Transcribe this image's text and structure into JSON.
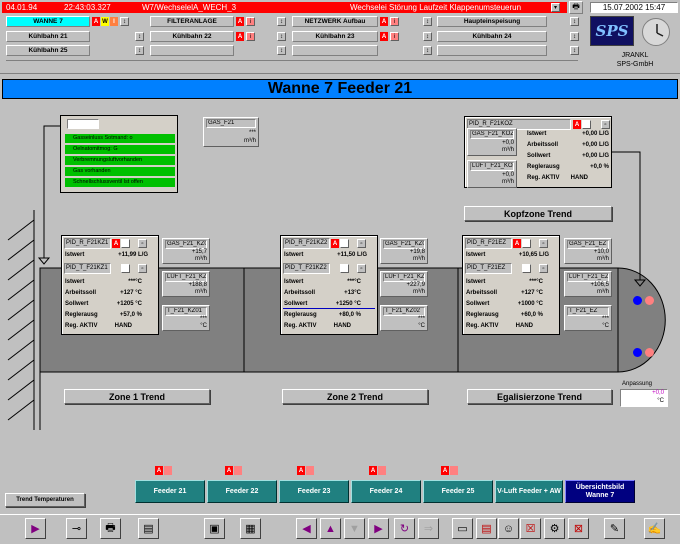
{
  "header": {
    "date": "04.01.94",
    "time": "22:43:03.327",
    "alarm_tag": "W7/WechselelA_WECH_3",
    "alarm_text": "Wechselei Störung Laufzeit Klappenumsteuerun",
    "datetime": "15.07.2002 15:47",
    "company_line1": "JRANKL",
    "company_line2": "SPS-GmbH",
    "logo_text": "SPS",
    "nav": [
      {
        "label": "WANNE 7",
        "active": true
      },
      {
        "label": "FILTERANLAGE"
      },
      {
        "label": "NETZWERK Aufbau"
      },
      {
        "label": "Haupteinspeisung"
      },
      {
        "label": "Kühlbahn 21"
      },
      {
        "label": "Kühlbahn 22"
      },
      {
        "label": "Kühlbahn 23"
      },
      {
        "label": "Kühlbahn 24"
      },
      {
        "label": "Kühlbahn 25"
      }
    ],
    "flag_a": "A",
    "flag_w": "W",
    "flag_i": "I"
  },
  "title": "Wanne 7 Feeder 21",
  "messages": [
    "Gasseinluss Sotmand: o",
    "Oelnatomitmog: G",
    "Verbremnungsluftvorhanden",
    "Gas vorhanden",
    "Schnellschlussventil lst offen"
  ],
  "gas_top": {
    "tag": "GAS_F21",
    "value": "***",
    "unit": "m³/h"
  },
  "kopfzone": {
    "pid": "PID_R_F21KOZ",
    "flag": "A",
    "rows": [
      {
        "label": "Istwert",
        "value": "+0,00 L/G"
      },
      {
        "label": "Arbeitssoll",
        "value": "+0,00 L/G"
      },
      {
        "label": "Sollwert",
        "value": "+0,00 L/G"
      },
      {
        "label": "Reglerausg",
        "value": "+0,0 %"
      },
      {
        "label": "Reg. AKTIV",
        "value": "HAND"
      }
    ],
    "gas": {
      "tag": "GAS_F21_KOZ",
      "value": "+0,0",
      "unit": "m³/h"
    },
    "luft": {
      "tag": "LUFT_F21_KOZ",
      "value": "+0,0",
      "unit": "m³/h"
    },
    "trend": "Kopfzone Trend"
  },
  "zones": [
    {
      "pid_r": "PID_R_F21KZ1",
      "pid_t": "PID_T_F21KZ1",
      "flag": "A",
      "istwert_r": "+11,99 L/G",
      "rows": [
        {
          "label": "Istwert",
          "value": "***°C"
        },
        {
          "label": "Arbeitssoll",
          "value": "+127 °C"
        },
        {
          "label": "Sollwert",
          "value": "+1205 °C"
        },
        {
          "label": "Reglerausg",
          "value": "+57,0 %"
        },
        {
          "label": "Reg. AKTIV",
          "value": "HAND"
        }
      ],
      "gas": {
        "tag": "GAS_F21_KZ01",
        "value": "+15,7",
        "unit": "m³/h"
      },
      "luft": {
        "tag": "LUFT_F21_KZ0",
        "value": "+188,8",
        "unit": "m³/h"
      },
      "t": {
        "tag": "T_F21_KZ01",
        "value": "***",
        "unit": "°C"
      },
      "trend": "Zone 1 Trend"
    },
    {
      "pid_r": "PID_R_F21KZ2",
      "pid_t": "PID_T_F21KZ2",
      "flag": "A",
      "istwert_r": "+11,50 L/G",
      "rows": [
        {
          "label": "Istwert",
          "value": "***°C"
        },
        {
          "label": "Arbeitssoll",
          "value": "+13°C"
        },
        {
          "label": "Sollwert",
          "value": "+1250 °C"
        },
        {
          "label": "Reglerausg",
          "value": "+80,0 %"
        },
        {
          "label": "Reg. AKTIV",
          "value": "HAND"
        }
      ],
      "gas": {
        "tag": "GAS_F21_KZ02",
        "value": "+19,8",
        "unit": "m³/h"
      },
      "luft": {
        "tag": "LUFT_F21_KZ0",
        "value": "+227,9",
        "unit": "m³/h"
      },
      "t": {
        "tag": "T_F21_KZ02",
        "value": "***",
        "unit": "°C"
      },
      "trend": "Zone 2 Trend"
    },
    {
      "pid_r": "PID_R_F21EZ",
      "pid_t": "PID_T_F21EZ",
      "flag": "A",
      "istwert_r": "+10,65 L/G",
      "rows": [
        {
          "label": "Istwert",
          "value": "***°C"
        },
        {
          "label": "Arbeitssoll",
          "value": "+127 °C"
        },
        {
          "label": "Sollwert",
          "value": "+1000 °C"
        },
        {
          "label": "Reglerausg",
          "value": "+60,0 %"
        },
        {
          "label": "Reg. AKTIV",
          "value": "HAND"
        }
      ],
      "gas": {
        "tag": "GAS_F21_EZ",
        "value": "+10,0",
        "unit": "m³/h"
      },
      "luft": {
        "tag": "LUFT_F21_EZ",
        "value": "+106,5",
        "unit": "m³/h"
      },
      "t": {
        "tag": "T_F21_EZ",
        "value": "***",
        "unit": "°C"
      },
      "trend": "Egalisierzone Trend"
    }
  ],
  "anpassung": {
    "label": "Anpassung",
    "value": "+0,0",
    "unit": "°C"
  },
  "trend_temp": "Trend Temperaturen",
  "feeders": [
    {
      "label": "Feeder 21"
    },
    {
      "label": "Feeder 22"
    },
    {
      "label": "Feeder 23"
    },
    {
      "label": "Feeder 24"
    },
    {
      "label": "Feeder 25"
    },
    {
      "label": "V-Luft Feeder + AW"
    },
    {
      "label": "Übersichtsbild Wanne 7"
    }
  ],
  "colors": {
    "title_bar": "#0080ff",
    "alarm_bar": "#ff0000",
    "feeder_btn": "#208080",
    "overview_btn": "#000080",
    "message_ok": "#00c000"
  }
}
